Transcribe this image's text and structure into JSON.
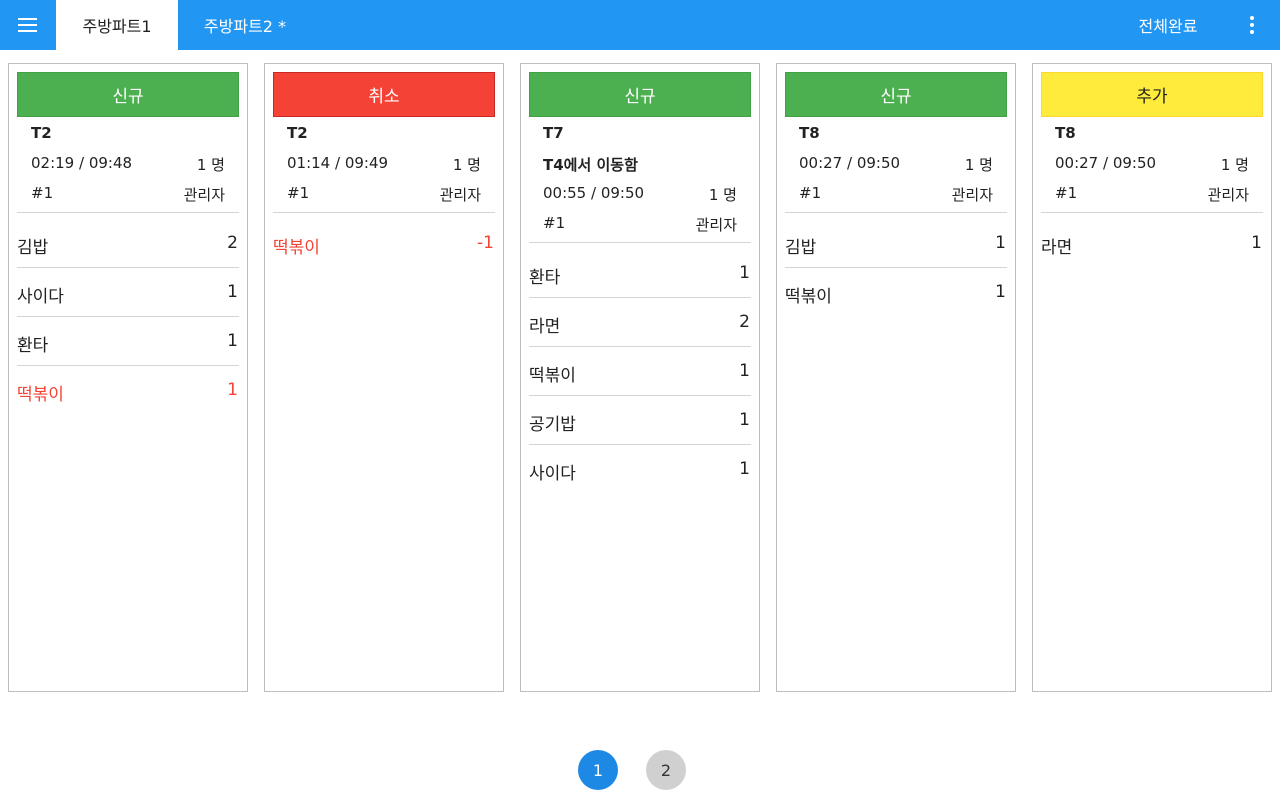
{
  "topbar": {
    "menu_icon": "hamburger-menu-icon",
    "tabs": [
      {
        "label": "주방파트1",
        "active": true
      },
      {
        "label": "주방파트2 *",
        "active": false
      }
    ],
    "complete_all_label": "전체완료",
    "more_icon": "more-vert-icon",
    "color": "#2196f3"
  },
  "cards": [
    {
      "status": "신규",
      "status_color": "#4caf50",
      "table": "T2",
      "time": "02:19 / 09:48",
      "people": "1 명",
      "order_no": "#1",
      "staff": "관리자",
      "items": [
        {
          "name": "김밥",
          "qty": "2",
          "cancelled": false
        },
        {
          "name": "사이다",
          "qty": "1",
          "cancelled": false
        },
        {
          "name": "환타",
          "qty": "1",
          "cancelled": false
        },
        {
          "name": "떡볶이",
          "qty": "1",
          "cancelled": true
        }
      ]
    },
    {
      "status": "취소",
      "status_color": "#f44336",
      "table": "T2",
      "time": "01:14 / 09:49",
      "people": "1 명",
      "order_no": "#1",
      "staff": "관리자",
      "items": [
        {
          "name": "떡볶이",
          "qty": "-1",
          "cancelled": true
        }
      ]
    },
    {
      "status": "신규",
      "status_color": "#4caf50",
      "table": "T7",
      "moved_note": "T4에서 이동함",
      "time": "00:55 / 09:50",
      "people": "1 명",
      "order_no": "#1",
      "staff": "관리자",
      "items": [
        {
          "name": "환타",
          "qty": "1",
          "cancelled": false
        },
        {
          "name": "라면",
          "qty": "2",
          "cancelled": false
        },
        {
          "name": "떡볶이",
          "qty": "1",
          "cancelled": false
        },
        {
          "name": "공기밥",
          "qty": "1",
          "cancelled": false
        },
        {
          "name": "사이다",
          "qty": "1",
          "cancelled": false
        }
      ]
    },
    {
      "status": "신규",
      "status_color": "#4caf50",
      "table": "T8",
      "time": "00:27 / 09:50",
      "people": "1 명",
      "order_no": "#1",
      "staff": "관리자",
      "items": [
        {
          "name": "김밥",
          "qty": "1",
          "cancelled": false
        },
        {
          "name": "떡볶이",
          "qty": "1",
          "cancelled": false
        }
      ]
    },
    {
      "status": "추가",
      "status_color": "#ffeb3b",
      "table": "T8",
      "time": "00:27 / 09:50",
      "people": "1 명",
      "order_no": "#1",
      "staff": "관리자",
      "items": [
        {
          "name": "라면",
          "qty": "1",
          "cancelled": false
        }
      ]
    }
  ],
  "pagination": {
    "pages": [
      "1",
      "2"
    ],
    "current": "1"
  }
}
